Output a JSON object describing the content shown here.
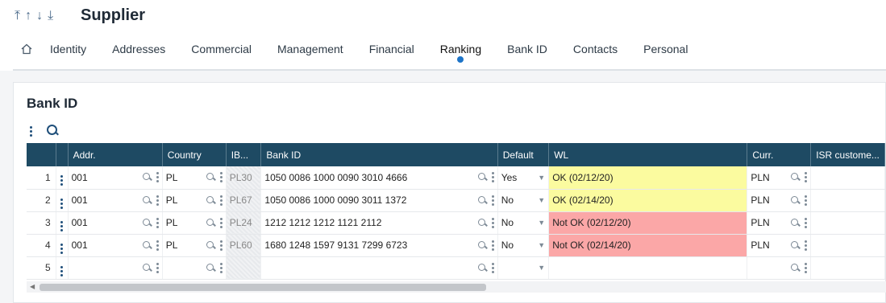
{
  "header": {
    "title": "Supplier",
    "nav": [
      "⤒",
      "↑",
      "↓",
      "⤓"
    ],
    "tabs": [
      "Identity",
      "Addresses",
      "Commercial",
      "Management",
      "Financial",
      "Ranking",
      "Bank ID",
      "Contacts",
      "Personal"
    ],
    "active_tab": "Ranking"
  },
  "panel": {
    "title": "Bank ID"
  },
  "table": {
    "columns": [
      "Addr.",
      "Country",
      "IB...",
      "Bank ID",
      "Default",
      "WL",
      "Curr.",
      "ISR custome..."
    ],
    "rows": [
      {
        "num": "1",
        "addr": "001",
        "country": "PL",
        "iban": "PL30",
        "bank_id": "1050 0086 1000 0090 3010 4666",
        "default": "Yes",
        "wl": "OK (02/12/20)",
        "wl_status": "ok",
        "curr": "PLN"
      },
      {
        "num": "2",
        "addr": "001",
        "country": "PL",
        "iban": "PL67",
        "bank_id": "1050 0086 1000 0090 3011 1372",
        "default": "No",
        "wl": "OK (02/14/20)",
        "wl_status": "ok",
        "curr": "PLN"
      },
      {
        "num": "3",
        "addr": "001",
        "country": "PL",
        "iban": "PL24",
        "bank_id": "1212 1212 1212 1121 2112",
        "default": "No",
        "wl": "Not OK (02/12/20)",
        "wl_status": "bad",
        "curr": "PLN"
      },
      {
        "num": "4",
        "addr": "001",
        "country": "PL",
        "iban": "PL60",
        "bank_id": "1680 1248 1597 9131 7299 6723",
        "default": "No",
        "wl": "Not OK (02/14/20)",
        "wl_status": "bad",
        "curr": "PLN"
      },
      {
        "num": "5",
        "addr": "",
        "country": "",
        "iban": "",
        "bank_id": "",
        "default": "",
        "wl": "",
        "wl_status": "",
        "curr": ""
      }
    ]
  },
  "colors": {
    "header_bg": "#1e4a63",
    "wl_ok": "#fbfb9f",
    "wl_bad": "#fba7a7",
    "accent": "#1d74c8"
  },
  "icons": {
    "home": "home-icon",
    "lookup": "magnifier-icon",
    "actions": "kebab-icon",
    "dropdown": "chevron-down-icon"
  }
}
